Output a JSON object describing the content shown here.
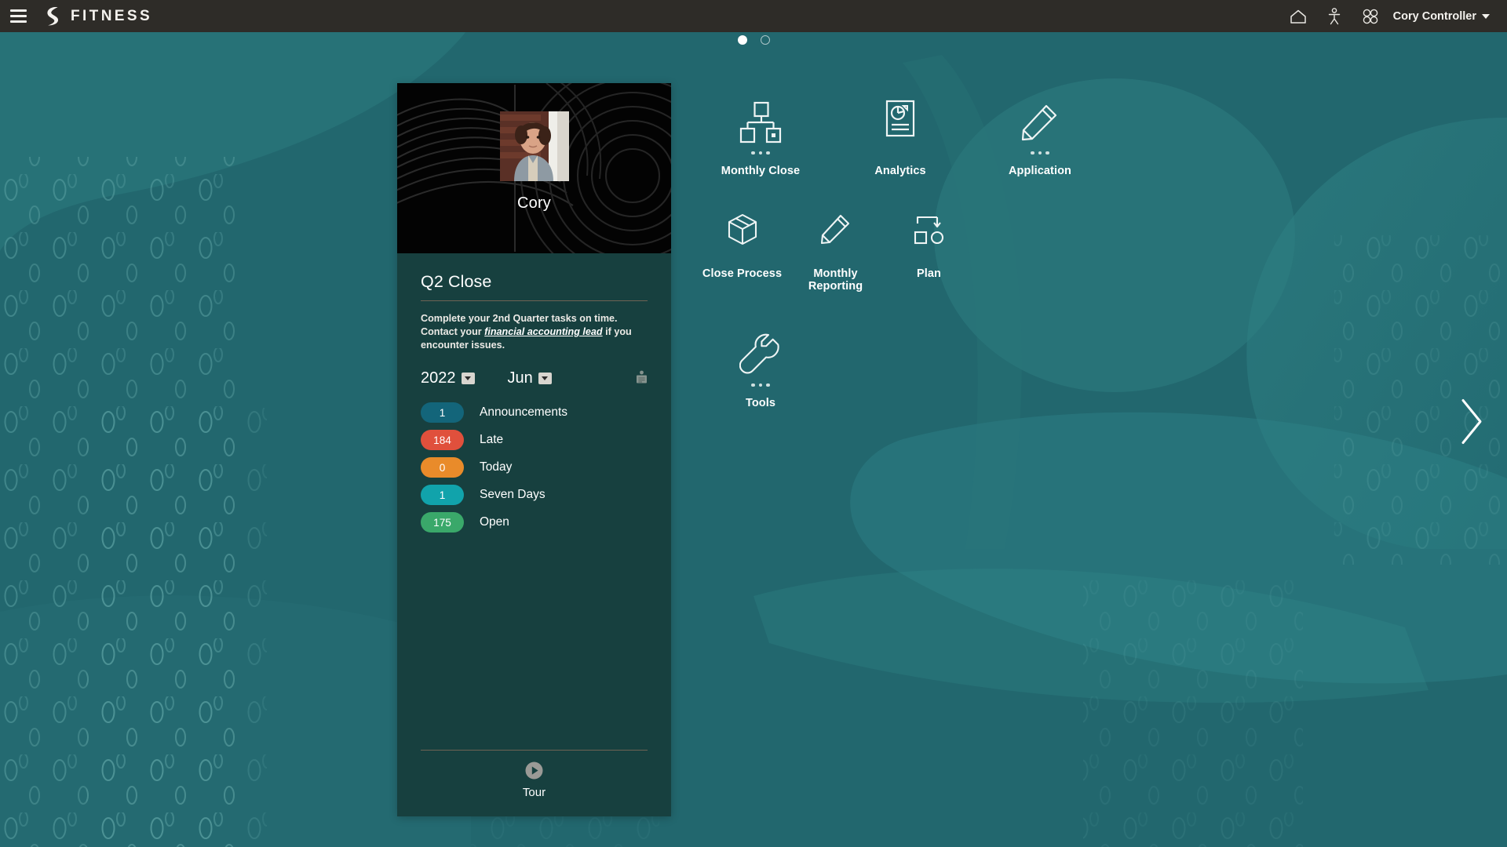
{
  "header": {
    "menu_icon": "hamburger-menu-icon",
    "brand": "FITNESS",
    "icons": [
      {
        "name": "home-icon",
        "glyph": "home"
      },
      {
        "name": "accessibility-icon",
        "glyph": "person"
      },
      {
        "name": "apps-grid-icon",
        "glyph": "grid"
      }
    ],
    "user": "Cory Controller"
  },
  "carousel": {
    "pages": 2,
    "active_page": 1
  },
  "card": {
    "avatar_name": "Cory",
    "title": "Q2 Close",
    "description_part1": "Complete your 2nd Quarter tasks on time.  Contact your ",
    "description_link": "financial accounting lead",
    "description_part2": " if you encounter issues.",
    "year": "2022",
    "month": "Jun",
    "tool_icon": "task-list-icon",
    "statuses": [
      {
        "count": "1",
        "label": "Announcements",
        "color": "#13657a"
      },
      {
        "count": "184",
        "label": "Late",
        "color": "#e0503c"
      },
      {
        "count": "0",
        "label": "Today",
        "color": "#e98b2a"
      },
      {
        "count": "1",
        "label": "Seven Days",
        "color": "#11a3ab"
      },
      {
        "count": "175",
        "label": "Open",
        "color": "#3aa86a"
      }
    ],
    "tour_label": "Tour",
    "tour_icon": "play-circle-icon"
  },
  "tiles": {
    "row1": [
      {
        "label": "Monthly Close",
        "icon": "hierarchy-icon",
        "has_dots": true
      },
      {
        "label": "Analytics",
        "icon": "document-pie-chart-icon",
        "has_dots": false
      },
      {
        "label": "Application",
        "icon": "pencil-icon",
        "has_dots": true
      }
    ],
    "row2": [
      {
        "label": "Close Process",
        "icon": "cube-icon",
        "has_dots": false
      },
      {
        "label": "Monthly Reporting",
        "icon": "pencil-icon",
        "has_dots": false
      },
      {
        "label": "Plan",
        "icon": "flow-diagram-icon",
        "has_dots": false
      }
    ],
    "row3": [
      {
        "label": "Tools",
        "icon": "wrench-icon",
        "has_dots": true
      }
    ]
  },
  "navigation": {
    "next_arrow": "chevron-right-icon"
  },
  "colors": {
    "background_teal": "#22676e",
    "card_teal": "#17403f",
    "header_dark": "#2e2c28"
  }
}
